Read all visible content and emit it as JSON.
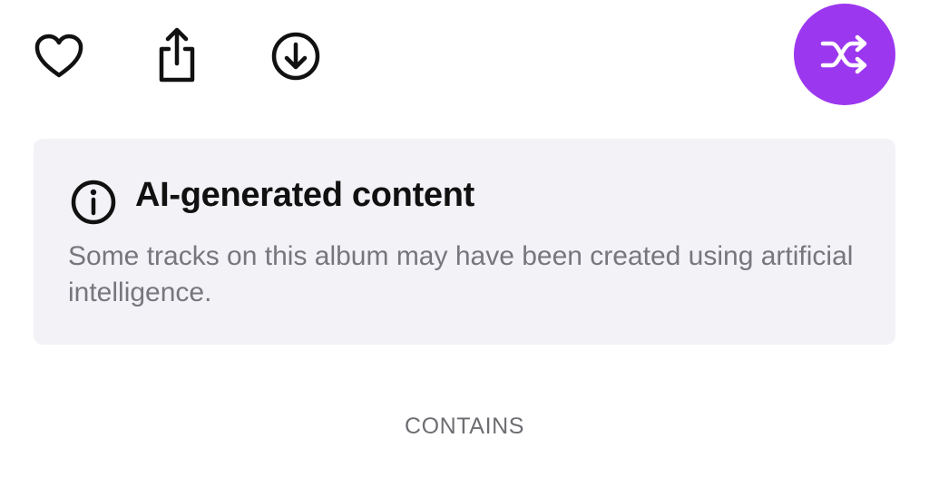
{
  "actions": {
    "like_icon": "heart-icon",
    "share_icon": "share-icon",
    "download_icon": "download-icon",
    "shuffle_icon": "shuffle-icon"
  },
  "notice": {
    "icon": "info-icon",
    "title": "AI-generated content",
    "body": "Some tracks on this album may have been created using artificial intelligence."
  },
  "section": {
    "label": "CONTAINS"
  },
  "colors": {
    "accent": "#9c37f0",
    "card_background": "#f3f2f7",
    "title_text": "#111111",
    "body_text": "#77767c",
    "label_text": "#6e6d72"
  }
}
